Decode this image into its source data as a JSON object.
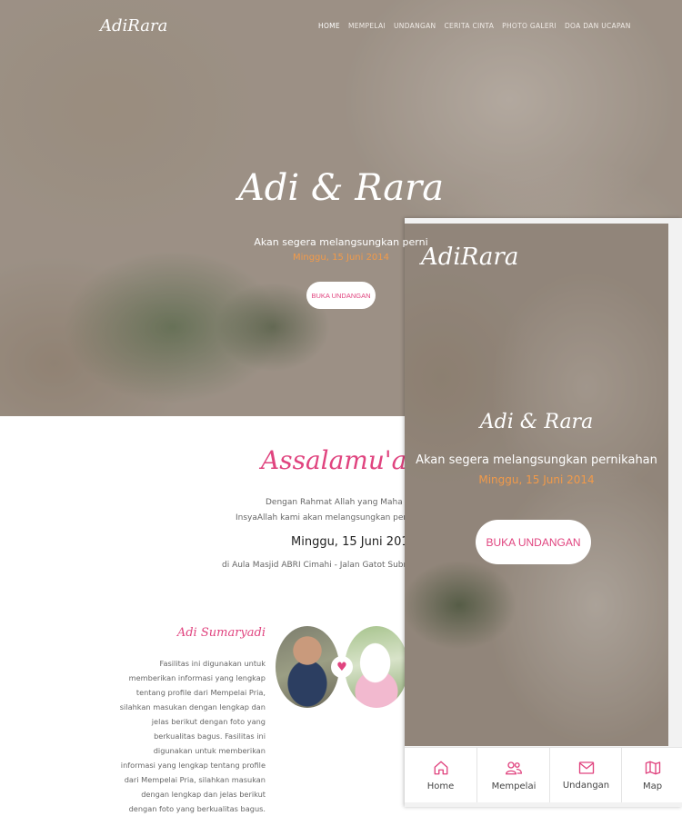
{
  "brand": {
    "logo": "AdiRara"
  },
  "nav": {
    "items": [
      {
        "label": "HOME",
        "active": true
      },
      {
        "label": "MEMPELAI"
      },
      {
        "label": "UNDANGAN"
      },
      {
        "label": "CERITA CINTA"
      },
      {
        "label": "PHOTO GALERI"
      },
      {
        "label": "DOA DAN UCAPAN"
      }
    ]
  },
  "hero": {
    "title": "Adi & Rara",
    "subtitle": "Akan segera melangsungkan perni",
    "date": "Minggu, 15 Juni 2014",
    "button": "BUKA UNDANGAN"
  },
  "invitation": {
    "greeting": "Assalamu'alaiku",
    "line1": "Dengan Rahmat Allah yang Maha K",
    "line2": "InsyaAllah kami akan melangsungkan pern",
    "date": "Minggu, 15 Juni 2014",
    "venue": "di Aula Masjid ABRI Cimahi - Jalan Gatot Subr"
  },
  "groom": {
    "name": "Adi Sumaryadi",
    "description": "Fasilitas ini digunakan untuk memberikan informasi yang lengkap tentang profile dari Mempelai Pria, silahkan masukan dengan lengkap dan jelas berikut dengan foto yang berkualitas bagus. Fasilitas ini digunakan untuk memberikan informasi yang lengkap tentang profile dari Mempelai Pria, silahkan masukan dengan lengkap dan jelas berikut dengan foto yang berkualitas bagus."
  },
  "mobile": {
    "logo": "AdiRara",
    "title": "Adi & Rara",
    "subtitle": "Akan segera melangsungkan pernikahan",
    "date": "Minggu, 15 Juni 2014",
    "button": "BUKA UNDANGAN",
    "tabs": [
      {
        "label": "Home",
        "icon": "home-icon"
      },
      {
        "label": "Mempelai",
        "icon": "users-icon"
      },
      {
        "label": "Undangan",
        "icon": "envelope-icon"
      },
      {
        "label": "Map",
        "icon": "map-icon"
      }
    ]
  },
  "colors": {
    "accent": "#e0447f",
    "date": "#f19a4a",
    "text": "#666666"
  }
}
